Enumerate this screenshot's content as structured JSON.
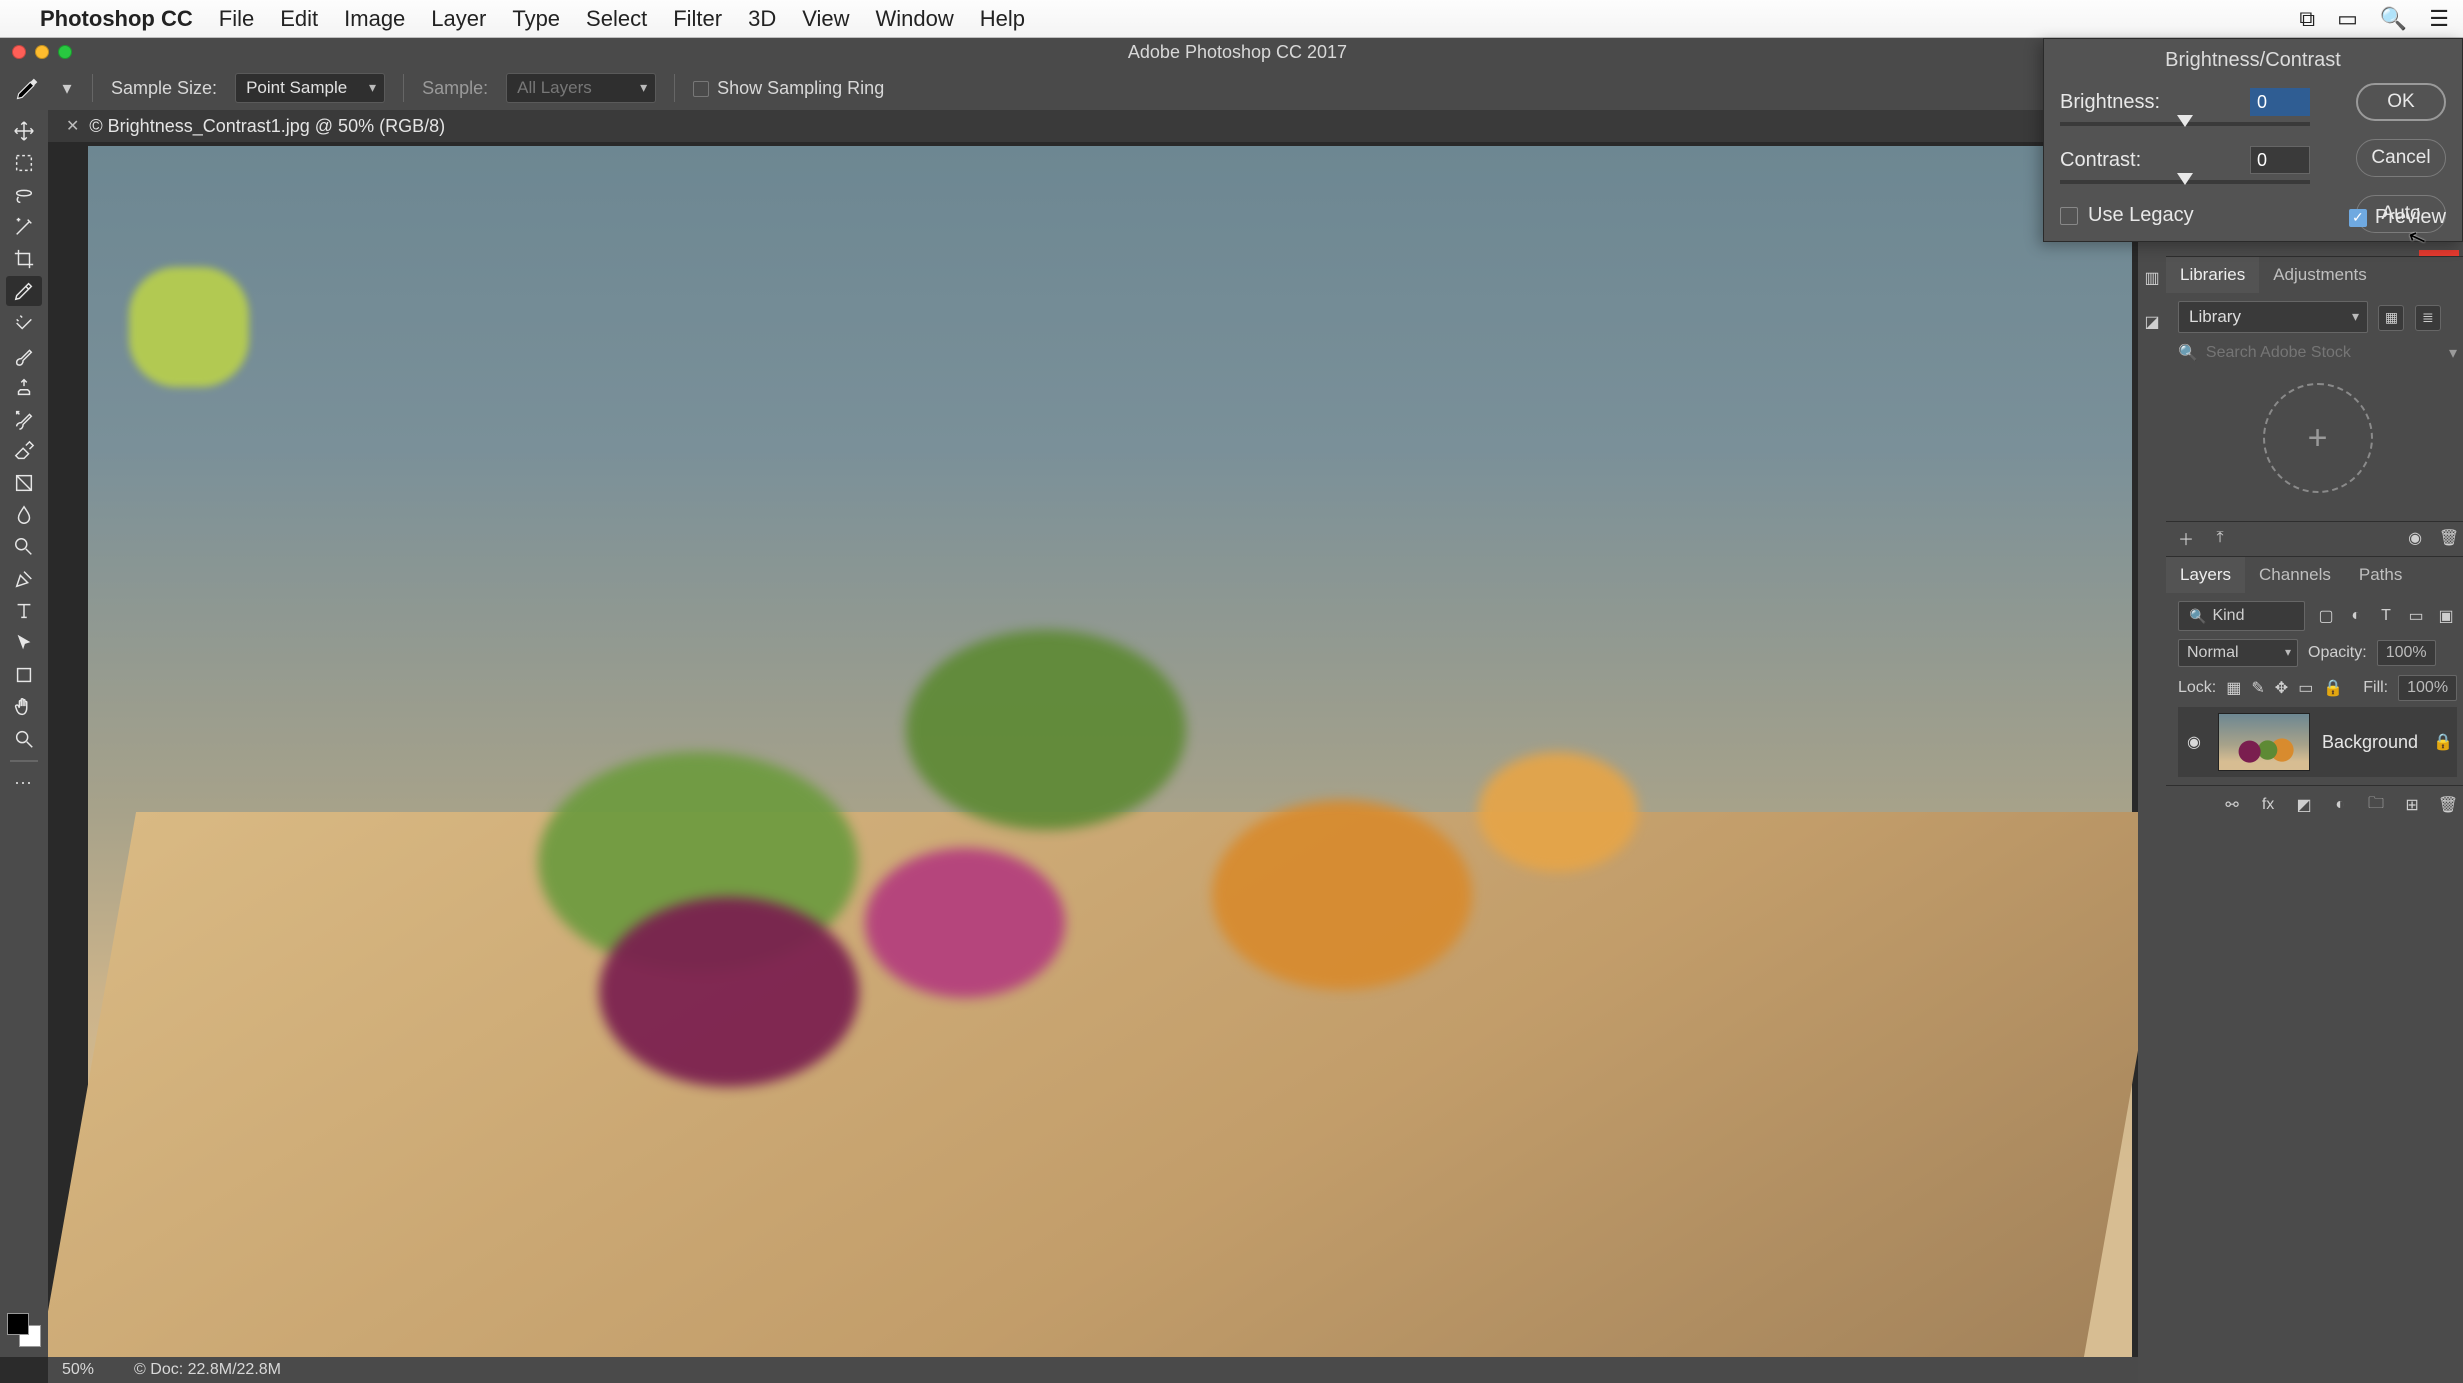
{
  "menubar": {
    "app": "Photoshop CC",
    "items": [
      "File",
      "Edit",
      "Image",
      "Layer",
      "Type",
      "Select",
      "Filter",
      "3D",
      "View",
      "Window",
      "Help"
    ]
  },
  "window": {
    "title": "Adobe Photoshop CC 2017"
  },
  "options_bar": {
    "sample_size_label": "Sample Size:",
    "sample_size_value": "Point Sample",
    "sample_label": "Sample:",
    "sample_value": "All Layers",
    "show_ring_label": "Show Sampling Ring"
  },
  "document": {
    "tab_label": "© Brightness_Contrast1.jpg @ 50% (RGB/8)"
  },
  "status": {
    "zoom": "50%",
    "docinfo": "© Doc: 22.8M/22.8M"
  },
  "tools": [
    "move-tool",
    "marquee-tool",
    "lasso-tool",
    "magic-wand-tool",
    "crop-tool",
    "eyedropper-tool",
    "spot-heal-tool",
    "brush-tool",
    "clone-stamp-tool",
    "history-brush-tool",
    "eraser-tool",
    "gradient-tool",
    "blur-tool",
    "dodge-tool",
    "pen-tool",
    "type-tool",
    "path-select-tool",
    "shape-tool",
    "hand-tool",
    "zoom-tool"
  ],
  "dialog": {
    "title": "Brightness/Contrast",
    "brightness_label": "Brightness:",
    "brightness_value": "0",
    "contrast_label": "Contrast:",
    "contrast_value": "0",
    "use_legacy_label": "Use Legacy",
    "preview_label": "Preview",
    "ok": "OK",
    "cancel": "Cancel",
    "auto": "Auto",
    "use_legacy_checked": false,
    "preview_checked": true
  },
  "libraries_panel": {
    "tabs": [
      "Libraries",
      "Adjustments"
    ],
    "active_tab": "Libraries",
    "dropdown_value": "Library",
    "search_placeholder": "Search Adobe Stock"
  },
  "layers_panel": {
    "tabs": [
      "Layers",
      "Channels",
      "Paths"
    ],
    "active_tab": "Layers",
    "kind_label": "Kind",
    "blend_mode": "Normal",
    "opacity_label": "Opacity:",
    "opacity_value": "100%",
    "lock_label": "Lock:",
    "fill_label": "Fill:",
    "fill_value": "100%",
    "layer_name": "Background"
  }
}
